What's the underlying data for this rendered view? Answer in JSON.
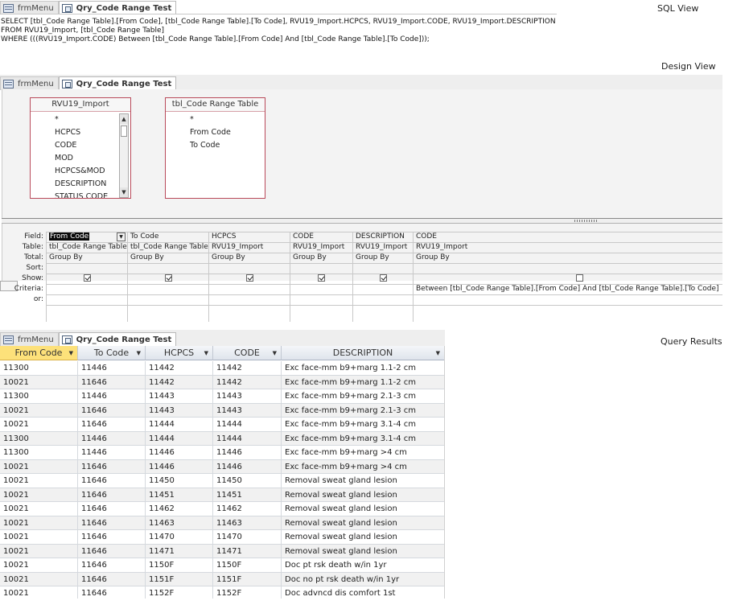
{
  "sql_view": {
    "label": "SQL View",
    "tabs": [
      {
        "label": "frmMenu",
        "icon": "form-icon",
        "active": false
      },
      {
        "label": "Qry_Code Range Test",
        "icon": "query-icon",
        "active": true
      }
    ],
    "lines": [
      "SELECT [tbl_Code Range Table].[From Code], [tbl_Code Range Table].[To Code], RVU19_Import.HCPCS, RVU19_Import.CODE, RVU19_Import.DESCRIPTION",
      "FROM RVU19_Import, [tbl_Code Range Table]",
      "WHERE (((RVU19_Import.CODE) Between [tbl_Code Range Table].[From Code] And [tbl_Code Range Table].[To Code]));"
    ]
  },
  "design_view": {
    "label": "Design View",
    "tabs": [
      {
        "label": "frmMenu",
        "icon": "form-icon",
        "active": false
      },
      {
        "label": "Qry_Code Range Test",
        "icon": "query-icon",
        "active": true
      }
    ],
    "tables": [
      {
        "name": "RVU19_Import",
        "fields": [
          "*",
          "HCPCS",
          "CODE",
          "MOD",
          "HCPCS&MOD",
          "DESCRIPTION",
          "STATUS CODE"
        ]
      },
      {
        "name": "tbl_Code Range Table",
        "fields": [
          "*",
          "From Code",
          "To Code"
        ]
      }
    ],
    "grid_labels": [
      "Field:",
      "Table:",
      "Total:",
      "Sort:",
      "Show:",
      "Criteria:",
      "or:"
    ],
    "columns": [
      {
        "field": "From Code",
        "table": "tbl_Code Range Table",
        "total": "Group By",
        "sort": "",
        "show": true,
        "criteria": "",
        "or": ""
      },
      {
        "field": "To Code",
        "table": "tbl_Code Range Table",
        "total": "Group By",
        "sort": "",
        "show": true,
        "criteria": "",
        "or": ""
      },
      {
        "field": "HCPCS",
        "table": "RVU19_Import",
        "total": "Group By",
        "sort": "",
        "show": true,
        "criteria": "",
        "or": ""
      },
      {
        "field": "CODE",
        "table": "RVU19_Import",
        "total": "Group By",
        "sort": "",
        "show": true,
        "criteria": "",
        "or": ""
      },
      {
        "field": "DESCRIPTION",
        "table": "RVU19_Import",
        "total": "Group By",
        "sort": "",
        "show": true,
        "criteria": "",
        "or": ""
      },
      {
        "field": "CODE",
        "table": "RVU19_Import",
        "total": "Group By",
        "sort": "",
        "show": false,
        "criteria": "Between [tbl_Code Range Table].[From Code] And [tbl_Code Range Table].[To Code]",
        "or": ""
      }
    ]
  },
  "query_results": {
    "label": "Query Results",
    "tabs": [
      {
        "label": "frmMenu",
        "icon": "form-icon",
        "active": false
      },
      {
        "label": "Qry_Code Range Test",
        "icon": "query-icon",
        "active": true
      }
    ],
    "headers": [
      "From Code",
      "To Code",
      "HCPCS",
      "CODE",
      "DESCRIPTION"
    ],
    "rows": [
      [
        "11300",
        "11446",
        "11442",
        "11442",
        "Exc face-mm b9+marg 1.1-2 cm"
      ],
      [
        "10021",
        "11646",
        "11442",
        "11442",
        "Exc face-mm b9+marg 1.1-2 cm"
      ],
      [
        "11300",
        "11446",
        "11443",
        "11443",
        "Exc face-mm b9+marg 2.1-3 cm"
      ],
      [
        "10021",
        "11646",
        "11443",
        "11443",
        "Exc face-mm b9+marg 2.1-3 cm"
      ],
      [
        "10021",
        "11646",
        "11444",
        "11444",
        "Exc face-mm b9+marg 3.1-4 cm"
      ],
      [
        "11300",
        "11446",
        "11444",
        "11444",
        "Exc face-mm b9+marg 3.1-4 cm"
      ],
      [
        "11300",
        "11446",
        "11446",
        "11446",
        "Exc face-mm b9+marg >4 cm"
      ],
      [
        "10021",
        "11646",
        "11446",
        "11446",
        "Exc face-mm b9+marg >4 cm"
      ],
      [
        "10021",
        "11646",
        "11450",
        "11450",
        "Removal sweat gland lesion"
      ],
      [
        "10021",
        "11646",
        "11451",
        "11451",
        "Removal sweat gland lesion"
      ],
      [
        "10021",
        "11646",
        "11462",
        "11462",
        "Removal sweat gland lesion"
      ],
      [
        "10021",
        "11646",
        "11463",
        "11463",
        "Removal sweat gland lesion"
      ],
      [
        "10021",
        "11646",
        "11470",
        "11470",
        "Removal sweat gland lesion"
      ],
      [
        "10021",
        "11646",
        "11471",
        "11471",
        "Removal sweat gland lesion"
      ],
      [
        "10021",
        "11646",
        "1150F",
        "1150F",
        "Doc pt rsk death w/in 1yr"
      ],
      [
        "10021",
        "11646",
        "1151F",
        "1151F",
        "Doc no pt rsk death w/in 1yr"
      ],
      [
        "10021",
        "11646",
        "1152F",
        "1152F",
        "Doc advncd dis comfort 1st"
      ]
    ]
  }
}
